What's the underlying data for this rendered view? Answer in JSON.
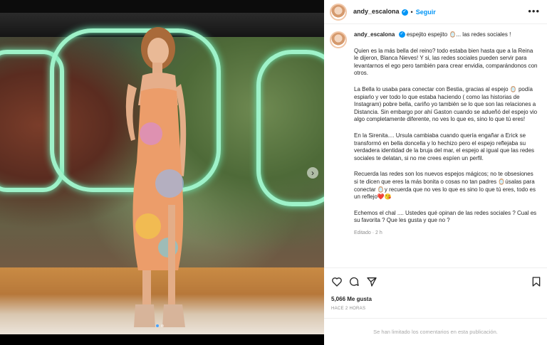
{
  "post": {
    "username": "andy_escalona",
    "follow_label": "Seguir",
    "separator": "•",
    "more_label": "•••",
    "caption_title": "espejito espejito 🪞... las redes sociales !",
    "paragraphs": [
      "Quien es la más bella del reino? todo estaba bien hasta que a la Reina le dijeron, Blanca Nieves! Y si, las redes sociales pueden servir para levantarnos el ego pero también para crear envidia, comparándonos con otros.",
      "La Bella lo usaba para conectar con Bestia, gracias al espejo 🪞 podía espiarlo y ver todo lo que estaba haciendo ( como las historias de Instagram) pobre bella, cariño yo también se lo que son las relaciones a Distancia. Sin embargo por ahí Gaston cuando se adueñó del espejo vio algo completamente diferente, no ves lo que es, sino lo que tú eres!",
      "En la Sirenita.... Ursula cambiaba cuando quería engañar a Erick se transformó en bella doncella y lo hechizo pero el espejo reflejaba su verdadera identidad de la bruja del mar, el espejo al igual que las redes sociales te delatan, si no me crees espíen un perfil.",
      "Recuerda las redes son los nuevos espejos mágicos; no te obsesiones si te dicen que eres la más bonita o cosas no tan padres 🪞úsalas para conectar 🪞y recuerda que no ves lo que es sino lo que tú eres, todo es un reflejo❤️😘",
      "Echemos el chal .... Ustedes qué opinan de las redes sociales ? Cual es su favorita ? Que les gusta y que no ?"
    ],
    "edited_label": "Editado",
    "edited_sep": "·",
    "edited_time": "2 h",
    "likes": "5,066 Me gusta",
    "time_ago": "HACE 2 HORAS",
    "comments_limited": "Se han limitado los comentarios en esta publicación."
  },
  "carousel": {
    "next_symbol": "›",
    "total_slides": 2,
    "active_slide": 1
  },
  "colors": {
    "accent": "#0095f6",
    "text": "#262626",
    "muted": "#8e8e8e",
    "neon": "#9ef2c9"
  },
  "icons": [
    "verified-icon",
    "more-icon",
    "heart-icon",
    "comment-icon",
    "share-icon",
    "bookmark-icon",
    "next-arrow-icon"
  ]
}
